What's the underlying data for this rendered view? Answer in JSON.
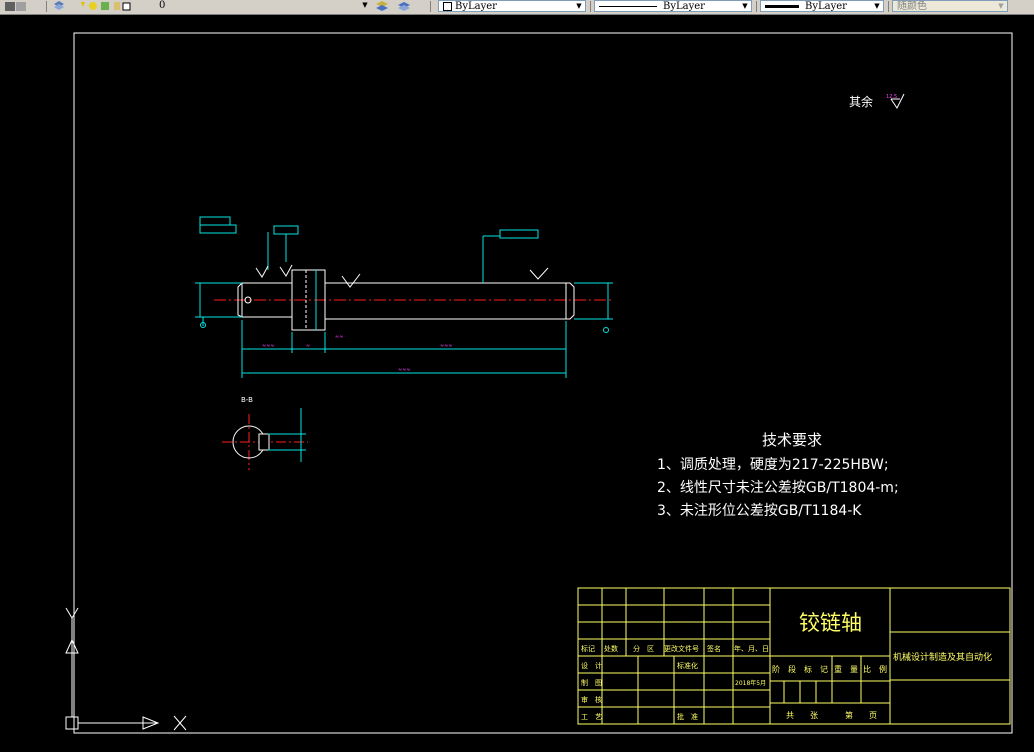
{
  "toolbar": {
    "layer_value": "0",
    "color_value": "ByLayer",
    "linetype_value": "ByLayer",
    "lineweight_value": "ByLayer",
    "plotstyle_value": "随颜色"
  },
  "drawing": {
    "surface_note": "其余",
    "section_label": "B-B",
    "tech_req": {
      "title": "技术要求",
      "items": [
        "1、调质处理，硬度为217-225HBW;",
        "2、线性尺寸未注公差按GB/T1804-m;",
        "3、未注形位公差按GB/T1184-K"
      ]
    },
    "title_block": {
      "part_name": "铰链轴",
      "company": "机械设计制造及其自动化",
      "rev_headers": [
        "标记",
        "处数",
        "分　区",
        "更改文件号",
        "签名",
        "年、月、日"
      ],
      "design": "设　计",
      "drawing": "制　图",
      "review": "审　核",
      "process": "工　艺",
      "standardize": "标准化",
      "approve": "批　准",
      "date": "2018年5月",
      "stage_labels": [
        "阶　段　标　记",
        "重　量",
        "比　例"
      ],
      "sheet_labels": [
        "共　　张",
        "第　　页"
      ]
    }
  },
  "colors": {
    "border": "#ffffff",
    "title_block": "#ffff66",
    "dimension": "#00e5e5",
    "centerline": "#ff2020",
    "dim_text": "#ff40ff",
    "tech_text": "#ffffff"
  }
}
